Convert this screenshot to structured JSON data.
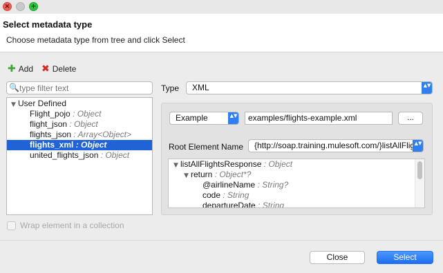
{
  "dialog": {
    "title": "Select metadata type",
    "description": "Choose metadata type from tree and click Select"
  },
  "window_controls": {
    "close": "×",
    "maximize": "+"
  },
  "toolbar": {
    "add_icon": "✚",
    "add_label": "Add",
    "delete_icon": "✖",
    "delete_label": "Delete"
  },
  "filter": {
    "placeholder": "type filter text",
    "icon": "🔍"
  },
  "tree": {
    "root": {
      "expander": "▼",
      "label": "User Defined"
    },
    "items": [
      {
        "name": "Flight_pojo",
        "type": ": Object"
      },
      {
        "name": "flight_json",
        "type": ": Object"
      },
      {
        "name": "flights_json",
        "type": ": Array<Object>"
      },
      {
        "name": "flights_xml",
        "type": ": Object"
      },
      {
        "name": "united_flights_json",
        "type": ": Object"
      }
    ],
    "selected_index": 3
  },
  "wrap_checkbox": {
    "label": "Wrap element in a collection",
    "checked": false
  },
  "type_field": {
    "label": "Type",
    "value": "XML"
  },
  "source": {
    "mode": "Example",
    "path": "examples/flights-example.xml",
    "browse_label": "..."
  },
  "root_element": {
    "label": "Root Element Name",
    "value": "{http://soap.training.mulesoft.com/}listAllFlightsResponse"
  },
  "xml_tree": {
    "expander": "▼",
    "rows": [
      {
        "name": "listAllFlightsResponse",
        "type": ": Object"
      },
      {
        "name": "return",
        "type": ": Object*?"
      },
      {
        "name": "@airlineName",
        "type": ": String?"
      },
      {
        "name": "code",
        "type": ": String"
      },
      {
        "name": "departureDate",
        "type": ": String"
      }
    ]
  },
  "select_arrows": "▲▼",
  "footer": {
    "close_label": "Close",
    "select_label": "Select"
  },
  "colors": {
    "accent": "#1f63d6",
    "button_primary": "#2f7ff0",
    "add_green": "#3aa52f",
    "delete_red": "#d8281e"
  }
}
